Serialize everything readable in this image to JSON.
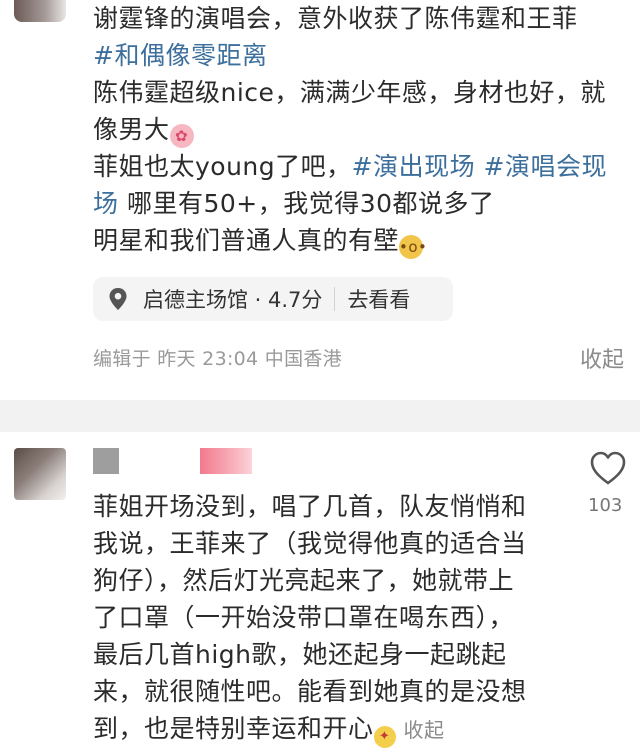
{
  "post": {
    "lines": [
      "谢霆锋的演唱会，意外收获了陈伟霆和王菲",
      "#和偶像零距离",
      "陈伟霆超级nice，满满少年感，身材也好，就",
      "像男大",
      "菲姐也太young了吧，",
      "#演出现场 #演唱会现",
      "场",
      " 哪里有50+，我觉得30都说多了",
      "明星和我们普通人真的有壁"
    ],
    "location": {
      "name": "启德主场馆 · 4.7分",
      "action": "去看看"
    },
    "meta": "编辑于  昨天 23:04  中国香港",
    "collapse_label": "收起"
  },
  "comment": {
    "like_count": "103",
    "lines": [
      "菲姐开场没到，唱了几首，队友悄悄和",
      "我说，王菲来了（我觉得他真的适合当",
      "狗仔），然后灯光亮起来了，她就带上",
      "了口罩（一开始没带口罩在喝东西），",
      "最后几首high歌，她还起身一起跳起",
      "来，就很随性吧。能看到她真的是没想",
      "到，也是特别幸运和开心"
    ],
    "collapse_label": "收起"
  },
  "icons": {
    "peach": "peach-emoji",
    "wow": "wow-face-emoji",
    "party": "party-face-emoji",
    "location": "location-pin-icon",
    "like": "heart-icon"
  },
  "colors": {
    "hashtag": "#3d6f9c",
    "meta": "#9a9a9a",
    "divider": "#f2f2f2"
  }
}
